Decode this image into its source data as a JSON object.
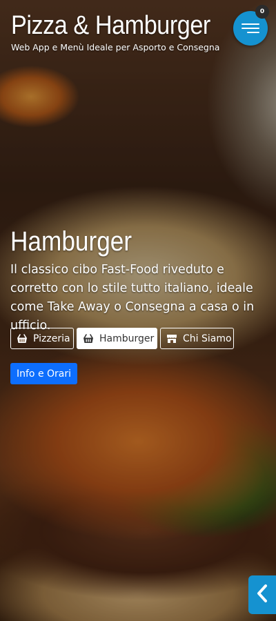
{
  "header": {
    "title": "Pizza & Hamburger",
    "subtitle": "Web App e Menù Ideale per Asporto e Consegna",
    "menu_icon": "hamburger-menu-icon",
    "cart_count": "0"
  },
  "hero": {
    "title": "Hamburger",
    "description": "Il classico cibo Fast-Food riveduto e corretto con lo stile tutto italiano, ideale come Take Away o Consegna a casa o in ufficio."
  },
  "tabs": [
    {
      "label": "Pizzeria",
      "icon": "basket-icon",
      "active": false
    },
    {
      "label": "Hamburger",
      "icon": "basket-icon",
      "active": true
    },
    {
      "label": "Chi Siamo",
      "icon": "store-icon",
      "active": false
    }
  ],
  "info_button": {
    "label": "Info e Orari"
  },
  "side_toggle": {
    "icon": "chevron-left-icon"
  },
  "colors": {
    "accent": "#1592d0",
    "info_button": "#0d6efd",
    "badge": "#2b2b2b"
  }
}
